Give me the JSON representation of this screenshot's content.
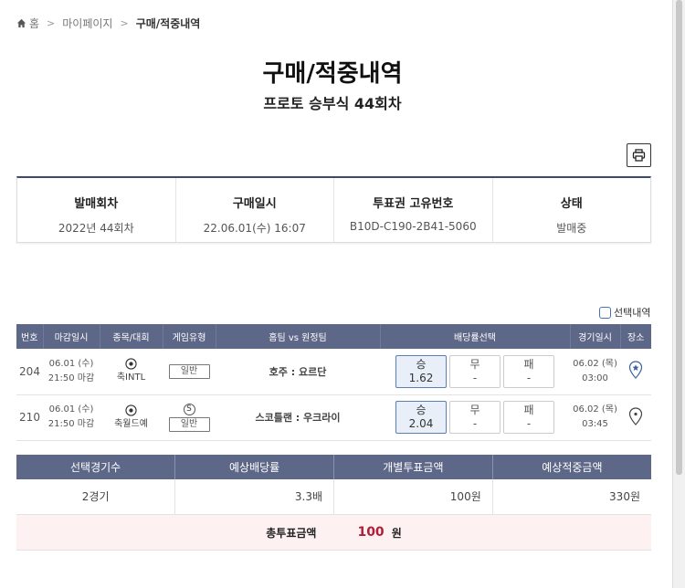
{
  "breadcrumb": {
    "home": "홈",
    "mypage": "마이페이지",
    "current": "구매/적중내역"
  },
  "page": {
    "title": "구매/적중내역",
    "subtitle": "프로토 승부식 44회차"
  },
  "info": [
    {
      "label": "발매회차",
      "value": "2022년 44회차"
    },
    {
      "label": "구매일시",
      "value": "22.06.01(수) 16:07"
    },
    {
      "label": "투표권 고유번호",
      "value": "B10D-C190-2B41-5060"
    },
    {
      "label": "상태",
      "value": "발매중"
    }
  ],
  "select_toggle": "선택내역",
  "games": {
    "headers": [
      "번호",
      "마감일시",
      "종목/대회",
      "게임유형",
      "홈팀 vs 원정팀",
      "배당률선택",
      "경기일시",
      "장소"
    ],
    "rows": [
      {
        "num": "204",
        "deadline_date": "06.01 (수)",
        "deadline_time": "21:50 마감",
        "league": "축INTL",
        "type": "일반",
        "special": "",
        "match": "호주 : 요르단",
        "odds": [
          {
            "label": "승",
            "value": "1.62"
          },
          {
            "label": "무",
            "value": "-"
          },
          {
            "label": "패",
            "value": "-"
          }
        ],
        "selected": 0,
        "game_date": "06.02 (목)",
        "game_time": "03:00"
      },
      {
        "num": "210",
        "deadline_date": "06.01 (수)",
        "deadline_time": "21:50 마감",
        "league": "축월드예",
        "type": "일반",
        "special": "S",
        "match": "스코틀랜 : 우크라이",
        "odds": [
          {
            "label": "승",
            "value": "2.04"
          },
          {
            "label": "무",
            "value": "-"
          },
          {
            "label": "패",
            "value": "-"
          }
        ],
        "selected": 0,
        "game_date": "06.02 (목)",
        "game_time": "03:45"
      }
    ]
  },
  "summary": {
    "headers": [
      "선택경기수",
      "예상배당률",
      "개별투표금액",
      "예상적중금액"
    ],
    "values": [
      "2경기",
      "3.3배",
      "100원",
      "330원"
    ],
    "total_label": "총투표금액",
    "total_amount": "100",
    "total_unit": "원"
  },
  "colors": {
    "header_bg": "#5d6787",
    "accent_red": "#b01e3a",
    "selected_odds_bg": "#e8eff9"
  }
}
